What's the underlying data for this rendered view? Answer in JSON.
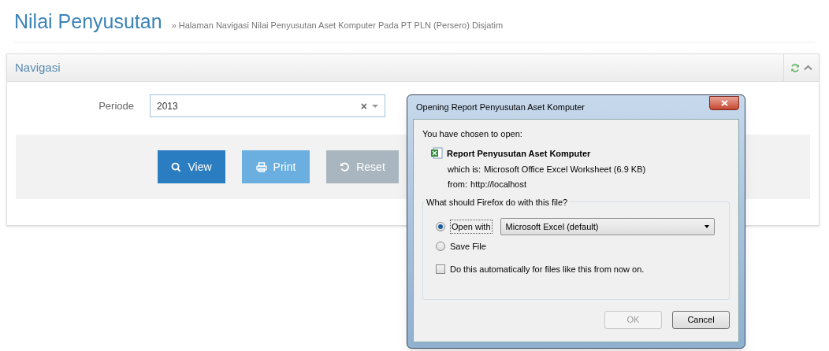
{
  "page_header": {
    "title": "Nilai Penyusutan",
    "subtitle": "» Halaman Navigasi Nilai Penyusutan Aset Komputer Pada PT PLN (Persero) Disjatim"
  },
  "panel": {
    "title": "Navigasi",
    "field": {
      "label": "Periode",
      "value": "2013",
      "clear_icon": "×"
    },
    "buttons": [
      {
        "label": "View",
        "kind": "primary"
      },
      {
        "label": "Print",
        "kind": "info"
      },
      {
        "label": "Reset",
        "kind": "muted"
      }
    ]
  },
  "dialog": {
    "title": "Opening Report Penyusutan Aset Komputer",
    "intro": "You have chosen to open:",
    "file_name": "Report Penyusutan Aset Komputer",
    "details": [
      {
        "label": "which is:",
        "value": "Microsoft Office Excel Worksheet (6.9 KB)"
      },
      {
        "label": "from:",
        "value": "http://localhost"
      }
    ],
    "group_title": "What should Firefox do with this file?",
    "options": [
      {
        "label": "Open with",
        "selected": true,
        "app": "Microsoft Excel (default)"
      },
      {
        "label": "Save File",
        "selected": false
      }
    ],
    "auto_checkbox": {
      "label": "Do this automatically for files like this from now on.",
      "checked": false
    },
    "buttons": [
      {
        "label": "OK",
        "disabled": true
      },
      {
        "label": "Cancel",
        "disabled": false
      }
    ]
  }
}
